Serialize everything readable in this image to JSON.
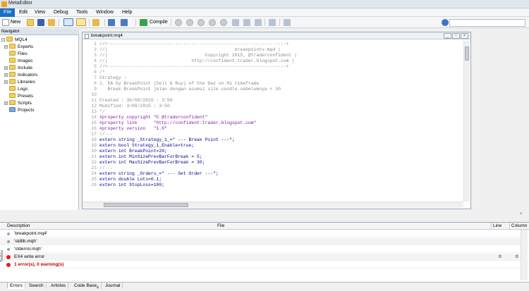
{
  "app": {
    "title": "MetaEditor"
  },
  "menu": [
    "File",
    "Edit",
    "View",
    "Debug",
    "Tools",
    "Window",
    "Help"
  ],
  "toolbar": {
    "new_label": "New",
    "compile_label": "Compile"
  },
  "navigator": {
    "title": "Navigator",
    "root": "MQL4",
    "items": [
      "Experts",
      "Files",
      "Images",
      "Include",
      "Indicators",
      "Libraries",
      "Logs",
      "Presets",
      "Scripts",
      "Projects"
    ]
  },
  "editor": {
    "tab_name": "breakpoint.mq4",
    "lines": [
      "//+------------------------------------------------------------------+",
      "//|                                               breakpointv.mq4 |",
      "//|                                    Copyright 2015, @traderconfident |",
      "//|                               http://confident-trader.blogspot.com |",
      "//+------------------------------------------------------------------+",
      "/*",
      "Strategy :",
      "1. EA by BreakPoint (Sell & Buy) of the Day on H1 timeframe",
      "   Break BreakPoint jalan dengan asumsi size candle sebelumnya < 30",
      "",
      "Created : 30/08/2015 : 3:50",
      "Modified: 3/09/2015 : 3:50",
      "*/",
      "#property copyright \"© @traderconfident\"",
      "#property link      \"http://confident-trader.blogspot.com\"",
      "#property version   \"1.0\"",
      "//---",
      "extern string _Strategy_1_=\" --- Break Point ---\";",
      "extern bool Strategy_1_Enable=true;",
      "extern int BreakPoint=20;",
      "extern int MinSizePrevBarForBreak = 5;",
      "extern int MaxSizePrevBarForBreak = 30;",
      "//---",
      "extern string _Orders_=\" --- Set Order ---\";",
      "extern double Lots=0.1;",
      "extern int StopLoss=100;"
    ]
  },
  "toolbox": {
    "columns": [
      "Description",
      "File",
      "Line",
      "Column"
    ],
    "rows": [
      {
        "text": "'breakpoint.mq4'",
        "line": "",
        "col": ""
      },
      {
        "text": "'stdlib.mqh'",
        "line": "",
        "col": ""
      },
      {
        "text": "'stderror.mqh'",
        "line": "",
        "col": ""
      },
      {
        "text": "EX4 write error",
        "line": "0",
        "col": "0"
      },
      {
        "text": "1 error(s), 0 warning(s)",
        "line": "",
        "col": ""
      }
    ],
    "side_label": "Toolbox",
    "tabs": [
      "Errors",
      "Search",
      "Articles",
      "Code Base",
      "Journal"
    ],
    "codebase_badge": "4"
  }
}
